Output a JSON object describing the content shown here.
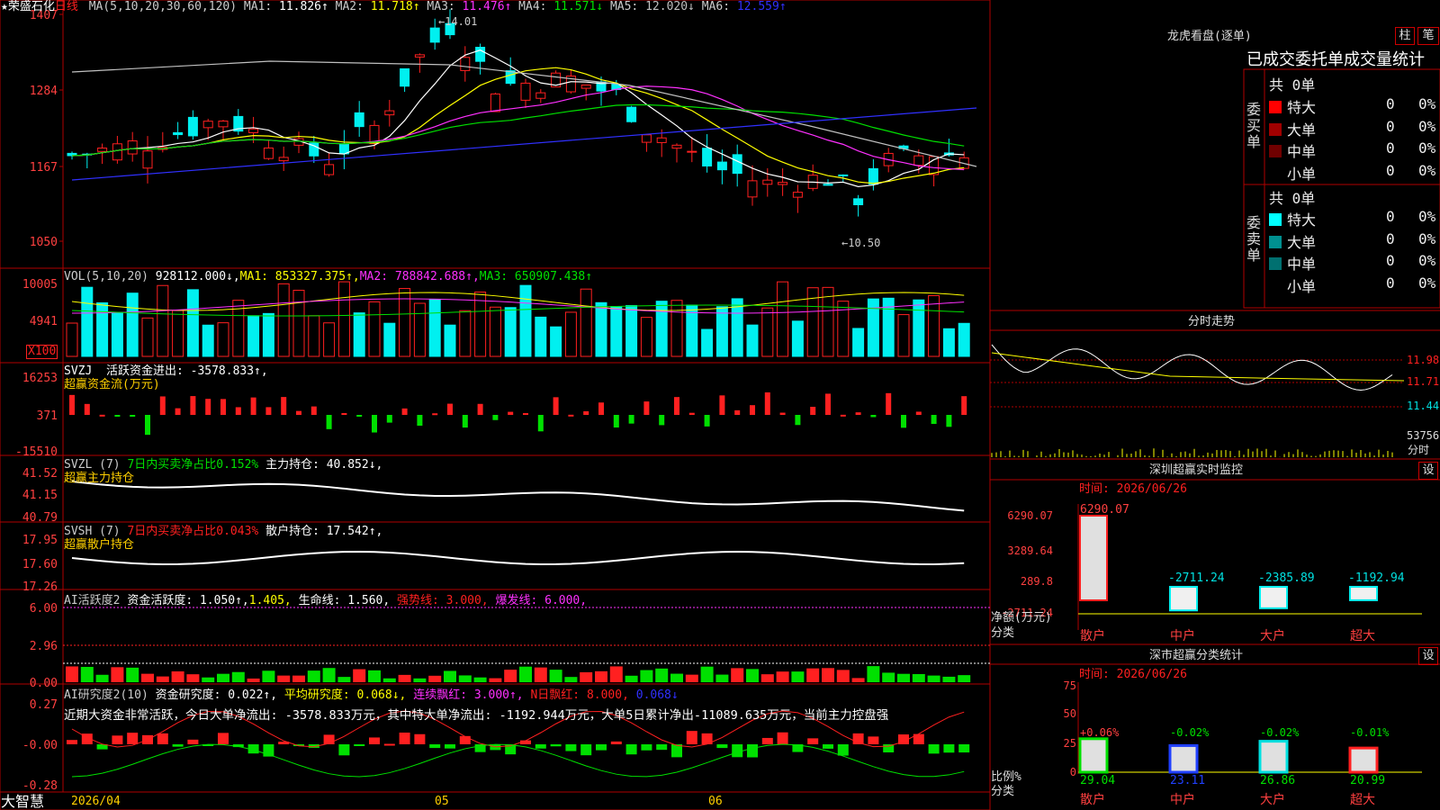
{
  "colors": {
    "up": "#ff2020",
    "down": "#00f0f0",
    "grid": "#b00000",
    "white": "#ffffff",
    "yellow": "#ffff00",
    "magenta": "#ff30ff",
    "green": "#00e000",
    "blue": "#3030ff",
    "gray": "#c0c0c0"
  },
  "main": {
    "stock_name": "荣盛石化",
    "period": "日线",
    "ma_title": "MA(5,10,20,30,60,120)",
    "ma_values": [
      {
        "label": "MA1:",
        "value": "11.826↑",
        "color": "#ffffff"
      },
      {
        "label": "MA2:",
        "value": "11.718↑",
        "color": "#ffff00"
      },
      {
        "label": "MA3:",
        "value": "11.476↑",
        "color": "#ff30ff"
      },
      {
        "label": "MA4:",
        "value": "11.571↓",
        "color": "#00e000"
      },
      {
        "label": "MA5:",
        "value": "12.020↓",
        "color": "#c0c0c0"
      },
      {
        "label": "MA6:",
        "value": "12.559↑",
        "color": "#3030ff"
      }
    ],
    "y_ticks": [
      "1407",
      "1284",
      "1167",
      "1050"
    ],
    "high_note": "←14.01",
    "low_note": "←10.50"
  },
  "vol": {
    "title": "VOL(5,10,20)",
    "value": "928112.000↓,",
    "mas": [
      {
        "label": "MA1:",
        "value": "853327.375↑,",
        "color": "#ffff00"
      },
      {
        "label": "MA2:",
        "value": "788842.688↑,",
        "color": "#ff30ff"
      },
      {
        "label": "MA3:",
        "value": "650907.438↑",
        "color": "#00e000"
      }
    ],
    "y_ticks": [
      "10005",
      "4941"
    ],
    "unit": "X100"
  },
  "svzj": {
    "title": "SVZJ",
    "text": "活跃资金进出: -3578.833↑,",
    "sub": "超赢资金流(万元)",
    "y_ticks": [
      "16253",
      "371",
      "-15510"
    ]
  },
  "svzl": {
    "title": "SVZL (7)",
    "t1": "7日内买卖净占比0.152%",
    "t2": "主力持仓: 40.852↓,",
    "sub": "超赢主力持仓",
    "y_ticks": [
      "41.52",
      "41.15",
      "40.79"
    ]
  },
  "svsh": {
    "title": "SVSH (7)",
    "t1": "7日内买卖净占比0.043%",
    "t2": "散户持仓: 17.542↑,",
    "sub": "超赢散户持仓",
    "y_ticks": [
      "17.95",
      "17.60",
      "17.26"
    ]
  },
  "ai1": {
    "title": "AI活跃度2",
    "t1": "资金活跃度: 1.050↑,",
    "t2": "1.405,",
    "t3": "生命线: 1.560,",
    "t4": "强势线: 3.000,",
    "t5": "爆发线: 6.000,",
    "y_ticks": [
      "6.00",
      "2.96",
      "0.00"
    ]
  },
  "ai2": {
    "title": "AI研究度2(10)",
    "t1": "资金研究度: 0.022↑,",
    "t2": "平均研究度: 0.068↓,",
    "t3": "连续飘红: 3.000↑,",
    "t4": "N日飘红: 8.000,",
    "t5": "0.068↓",
    "comment": "近期大资金非常活跃，今日大单净流出: -3578.833万元，其中特大单净流出: -1192.944万元，大单5日累计净出-11089.635万元，当前主力控盘强",
    "y_ticks": [
      "0.27",
      "-0.00",
      "-0.28"
    ]
  },
  "bottom": {
    "brand": "大智慧",
    "date": "2026/04",
    "m1": "05",
    "m2": "06"
  },
  "lhb": {
    "title": "龙虎看盘(逐单)",
    "btn1": "柱",
    "btn2": "笔",
    "tabs": "已成交委托单成交量统计",
    "buy_label": "委买单",
    "sell_label": "委卖单",
    "buy_total": "共 0单",
    "sell_total": "共 0单",
    "buy_rows": [
      {
        "name": "特大",
        "n": "0",
        "p": "0%",
        "color": "#ff0000"
      },
      {
        "name": "大单",
        "n": "0",
        "p": "0%",
        "color": "#a00000"
      },
      {
        "name": "中单",
        "n": "0",
        "p": "0%",
        "color": "#700000"
      },
      {
        "name": "小单",
        "n": "0",
        "p": "0%",
        "color": "#000000"
      }
    ],
    "sell_rows": [
      {
        "name": "特大",
        "n": "0",
        "p": "0%",
        "color": "#00ffff"
      },
      {
        "name": "大单",
        "n": "0",
        "p": "0%",
        "color": "#009090"
      },
      {
        "name": "中单",
        "n": "0",
        "p": "0%",
        "color": "#007070"
      },
      {
        "name": "小单",
        "n": "0",
        "p": "0%",
        "color": "#000000"
      }
    ]
  },
  "fenshi": {
    "title": "分时走势",
    "y_ticks": [
      "11.98",
      "11.71",
      "11.44",
      "53756"
    ],
    "unit": "分时"
  },
  "monitor": {
    "title": "深圳超赢实时监控",
    "btn": "设",
    "time": "时间: 2026/06/26",
    "y_ticks": [
      "6290.07",
      "3289.64",
      "289.8",
      "-2711.24"
    ],
    "ylabel": "净额(万元)",
    "xlabel": "分类",
    "bars": [
      {
        "cat": "散户",
        "label": "6290.07",
        "value": 6290.07
      },
      {
        "cat": "中户",
        "label": "-2711.24",
        "value": -2711.24
      },
      {
        "cat": "大户",
        "label": "-2385.89",
        "value": -2385.89
      },
      {
        "cat": "超大",
        "label": "-1192.94",
        "value": -1192.94
      }
    ]
  },
  "classify": {
    "title": "深市超赢分类统计",
    "btn": "设",
    "time": "时间: 2026/06/26",
    "y_ticks": [
      "75",
      "50",
      "25",
      "0"
    ],
    "ylabel": "比例%",
    "xlabel": "分类",
    "bars": [
      {
        "cat": "散户",
        "pct": 29.04,
        "top": "+0.06%",
        "bottom": "29.04"
      },
      {
        "cat": "中户",
        "pct": 23.11,
        "top": "-0.02%",
        "bottom": "23.11"
      },
      {
        "cat": "大户",
        "pct": 26.86,
        "top": "-0.02%",
        "bottom": "26.86"
      },
      {
        "cat": "超大",
        "pct": 20.99,
        "top": "-0.01%",
        "bottom": "20.99"
      }
    ]
  }
}
